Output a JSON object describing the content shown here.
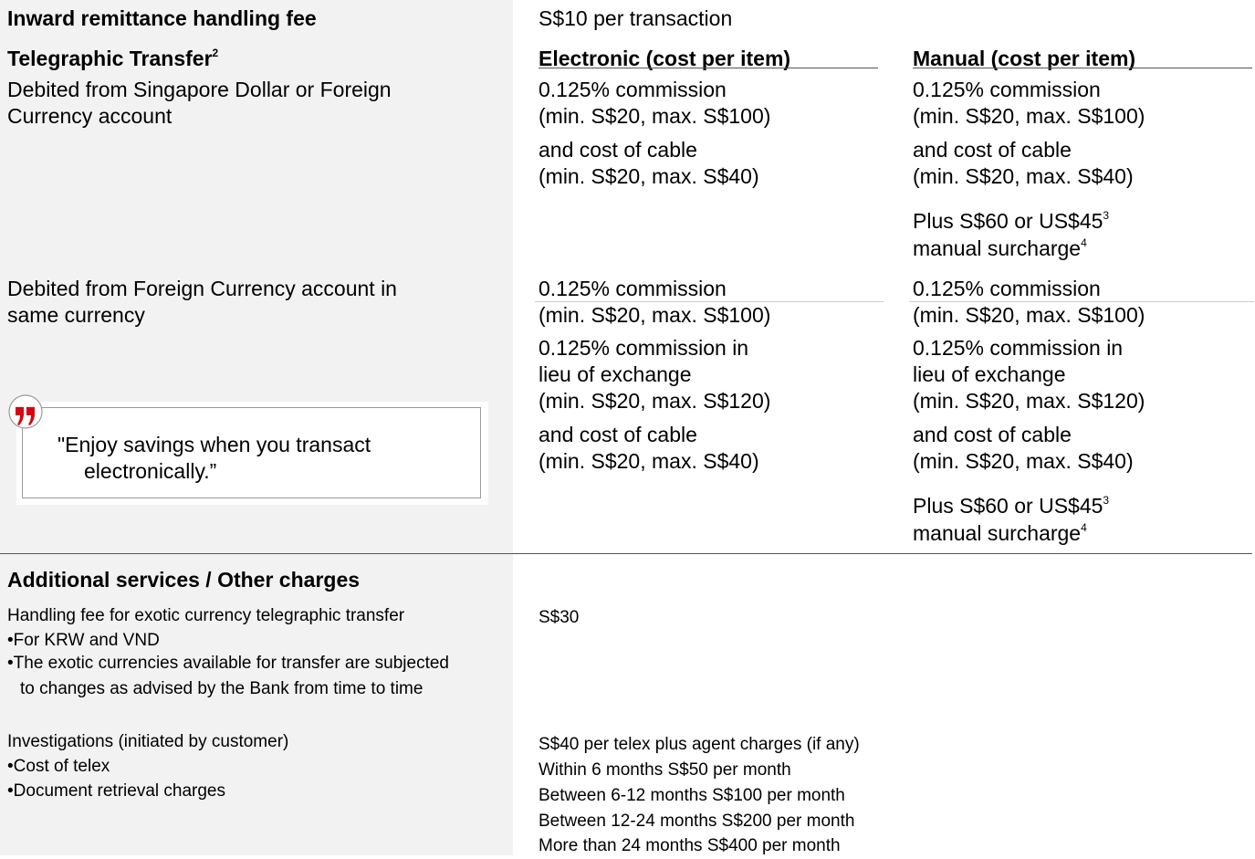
{
  "inward": {
    "label": "Inward remittance handling fee",
    "value": "S$10 per transaction"
  },
  "tt": {
    "title": "Telegraphic Transfer",
    "title_sup": "2",
    "electronic_header": "Electronic (cost per item)",
    "manual_header": "Manual (cost per item)",
    "sgd_label_1": "Debited from Singapore Dollar or Foreign",
    "sgd_label_2": "Currency account",
    "fc_label_1": "Debited from Foreign Currency account in",
    "fc_label_2": "same currency",
    "commission": "0.125% commission",
    "min100": "(min. S$20, max. S$100)",
    "cable": "and cost of cable",
    "min40": "(min. S$20, max. S$40)",
    "surcharge_1": "Plus S$60 or US$45",
    "surcharge_1_sup": "3",
    "surcharge_2": "manual surcharge",
    "surcharge_2_sup": "4",
    "comm_lieu_1": "0.125% commission in",
    "comm_lieu_2": "lieu of exchange",
    "min120": "(min. S$20, max. S$120)"
  },
  "quote": {
    "line1": "\"Enjoy savings when you transact",
    "line2": "electronically.”"
  },
  "additional": {
    "title": "Additional services / Other charges",
    "exotic_label": "Handling fee for exotic currency telegraphic transfer",
    "exotic_b1": "•For KRW and VND",
    "exotic_b2a": "•The exotic currencies available for transfer are subjected",
    "exotic_b2b": "to changes as advised by the Bank from time to time",
    "exotic_value": "S$30",
    "inv_label": "Investigations (initiated by customer)",
    "inv_b1": "•Cost of telex",
    "inv_b2": "•Document retrieval charges",
    "inv_v1": "S$40 per telex plus agent charges (if any)",
    "inv_v2": "Within 6 months S$50 per month",
    "inv_v3": "Between 6-12 months S$100 per month",
    "inv_v4": "Between 12-24 months S$200 per month",
    "inv_v5": "More than 24 months S$400 per month"
  },
  "colors": {
    "accent_red": "#db0011",
    "left_bg": "#f2f2f2"
  },
  "icons": {
    "quote": "quote-mark-icon"
  }
}
